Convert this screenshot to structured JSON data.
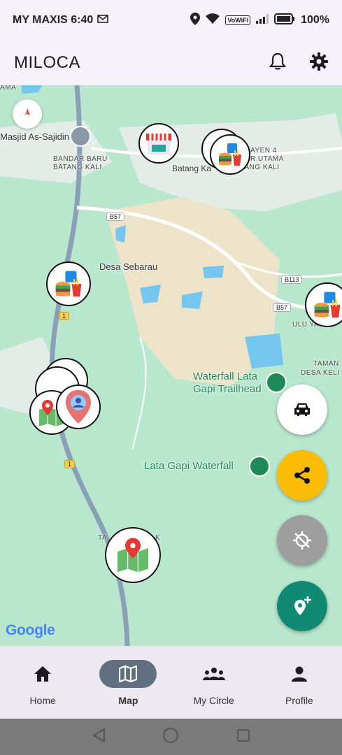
{
  "status_bar": {
    "carrier_time": "MY MAXIS 6:40",
    "volte": "VoWiFi",
    "battery": "100%"
  },
  "app_bar": {
    "title": "MILOCA",
    "icons": [
      "bell-icon",
      "gear-icon"
    ]
  },
  "map": {
    "labels": {
      "masjid": "Masjid As-Sajidin",
      "bandar_baru_1": "BANDAR BARU",
      "bandar_baru_2": "BATANG KALI",
      "batang_kali": "Batang Ka",
      "utama_1": "AYEN 4",
      "utama_2": "R UTAMA",
      "utama_3": "BATANG KALI",
      "desa_sebarau": "Desa Sebarau",
      "ulu_yam": "ULU YAM",
      "taman_1": "TAMAN",
      "taman_2": "DESA KELI",
      "waterfall_1": "Waterfall Lata",
      "waterfall_2": "Gapi Trailhead",
      "lata_gapi": "Lata Gapi Waterfall",
      "tamak": "TA",
      "tamak_end": "K",
      "top_left": "AMA"
    },
    "road_badges": {
      "b57_top": "B57",
      "b113": "B113",
      "b57_right": "B57",
      "r1_a": "1",
      "r1_b": "1"
    },
    "attribution": "Google"
  },
  "fabs": [
    "car-icon",
    "share-icon",
    "gps-off-icon",
    "add-location-icon"
  ],
  "bottom_nav": {
    "items": [
      {
        "label": "Home",
        "icon": "home-icon"
      },
      {
        "label": "Map",
        "icon": "map-icon"
      },
      {
        "label": "My Circle",
        "icon": "group-icon"
      },
      {
        "label": "Profile",
        "icon": "person-icon"
      }
    ]
  }
}
